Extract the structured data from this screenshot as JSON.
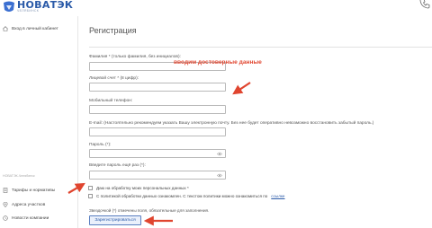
{
  "header": {
    "logo_text": "НОВАТЭК",
    "logo_sub": "ЧЕЛЯБИНСК"
  },
  "sidebar": {
    "login_label": "Вход в личный кабинет",
    "section_label": "НОВАТЭК-Челябинск",
    "items": [
      {
        "label": "Тарифы и нормативы"
      },
      {
        "label": "Адреса участков"
      },
      {
        "label": "Новости компании"
      }
    ]
  },
  "form": {
    "title": "Регистрация",
    "surname_label": "Фамилия * (только фамилия, без инициалов):",
    "account_label": "Лицевой счет * (8 цифр):",
    "mobile_label": "Мобильный телефон:",
    "email_label": "E-mail: (Настоятельно рекомендуем указать Вашу электронную почту. Без нее будет оперативно невозможно восстановить забытый пароль.)",
    "password_label": "Пароль (*):",
    "password_repeat_label": "Введите пароль ещё раз (*):",
    "consent_label": "Даю на обработку моих персональных данных *",
    "policy_label": "С политикой обработки данных ознакомлен. С текстом политики можно ознакомиться по",
    "policy_link": "ссылке",
    "required_note": "Звездочкой (*) отмечены поля, обязательные для заполнения.",
    "submit_label": "Зарегистрироваться"
  },
  "annotation": {
    "text": "вводим достоверные данные",
    "color": "#e0452f"
  },
  "colors": {
    "brand": "#2a5aa8",
    "accent_arrow": "#e0452f"
  }
}
